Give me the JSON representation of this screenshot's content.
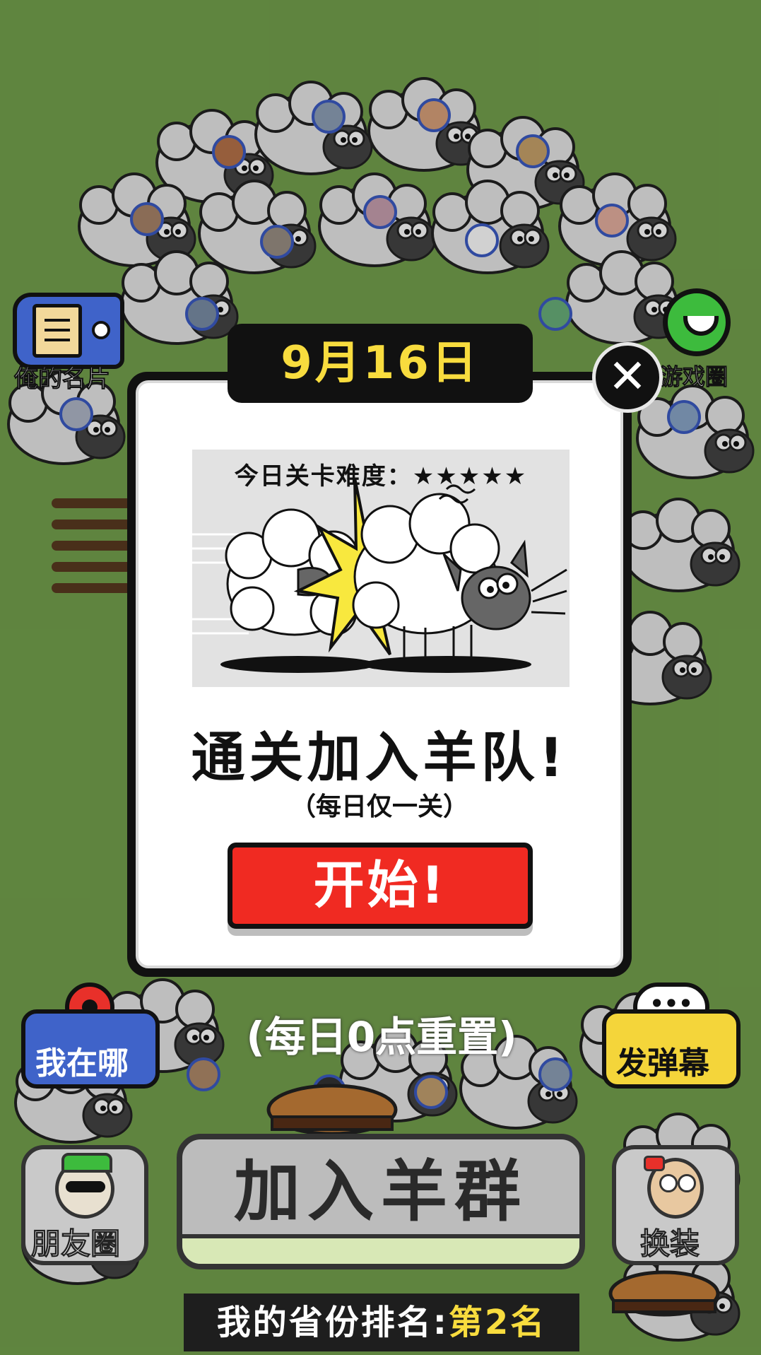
{
  "colors": {
    "background": "#74a24d",
    "date_text": "#f8dc3e",
    "start_button": "#f02a22",
    "rank_highlight": "#f8dc3e"
  },
  "top_left_button": {
    "label": "俺的名片",
    "icon": "card-tag-icon"
  },
  "top_right_button": {
    "label": "游戏圈",
    "icon": "chat-smile-icon"
  },
  "modal": {
    "date": "9月16日",
    "close_symbol": "✕",
    "difficulty_label": "今日关卡难度：",
    "difficulty_stars": "★★★★★",
    "difficulty_rating": 5,
    "title": "通关加入羊队!",
    "subtitle": "（每日仅一关）",
    "start_button_label": "开始!"
  },
  "reset_note": "(每日0点重置)",
  "left_mid_button": {
    "label": "我在哪",
    "icon": "location-pin-icon"
  },
  "right_mid_button": {
    "label": "发弹幕",
    "icon": "speech-bubble-icon"
  },
  "left_bottom_button": {
    "label": "朋友圈",
    "icon": "cool-sheep-icon"
  },
  "right_bottom_button": {
    "label": "换装",
    "icon": "dressed-sheep-icon"
  },
  "join_herd_label": "加入羊群",
  "rank": {
    "label": "我的省份排名:",
    "value": "第2名"
  }
}
